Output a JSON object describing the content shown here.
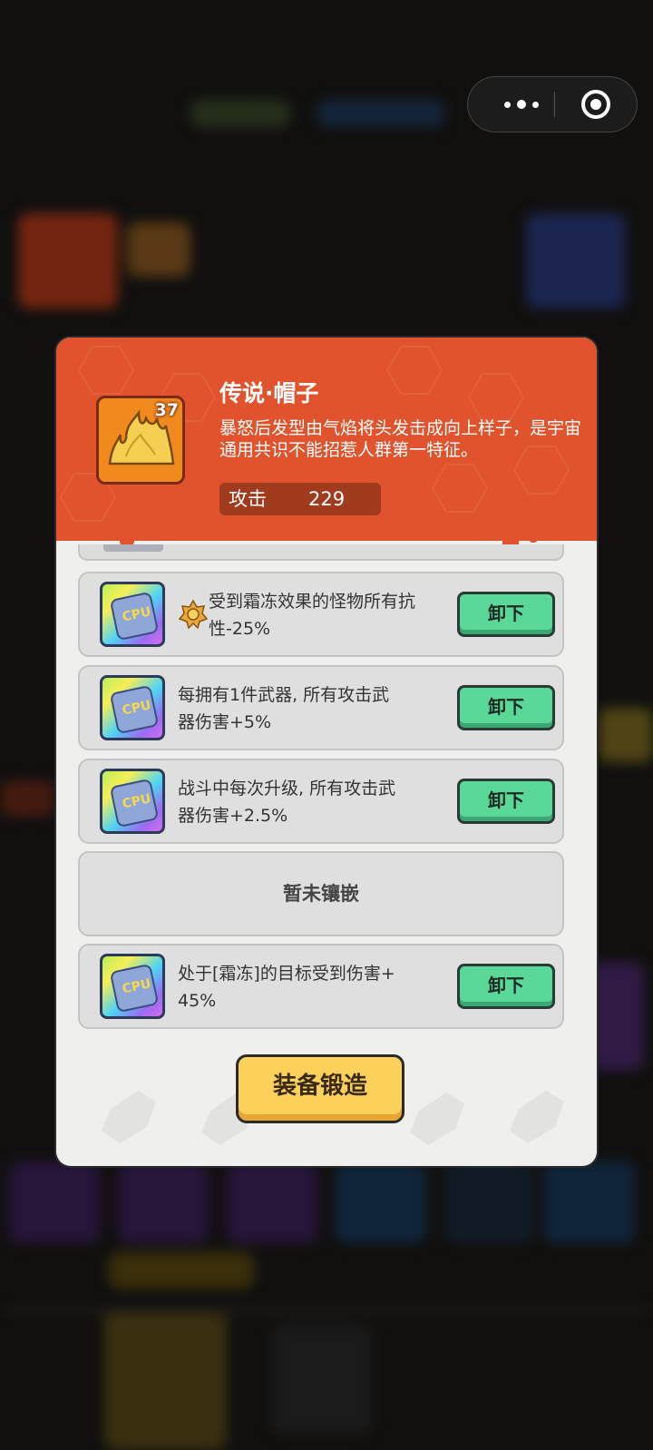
{
  "colors": {
    "header": "#e0532c",
    "dialog_bg": "#efefed",
    "unequip_button": "#5ad898",
    "forge_button": "#fbd159"
  },
  "capsule": {
    "more_icon": "more-dots-icon",
    "close_icon": "target-close-icon"
  },
  "item": {
    "icon": "golden-hair-icon",
    "level": "37",
    "title": "传说·帽子",
    "description": "暴怒后发型由气焰将头发击成向上样子，是宇宙通用共识不能招惹人群第一特征。",
    "stat_label": "攻击",
    "stat_value": "229"
  },
  "slots": [
    {
      "line1": "受到霜冻效果的怪物所有抗",
      "line2": "性-25%",
      "button": "卸下",
      "has_badge": true
    },
    {
      "line1": "每拥有1件武器, 所有攻击武",
      "line2": "器伤害+5%",
      "button": "卸下"
    },
    {
      "line1": "战斗中每次升级, 所有攻击武",
      "line2": "器伤害+2.5%",
      "button": "卸下"
    },
    {
      "empty_text": "暂未镶嵌"
    },
    {
      "line1": "处于[霜冻]的目标受到伤害+",
      "line2": "45%",
      "button": "卸下"
    }
  ],
  "forge_button": "装备锻造"
}
